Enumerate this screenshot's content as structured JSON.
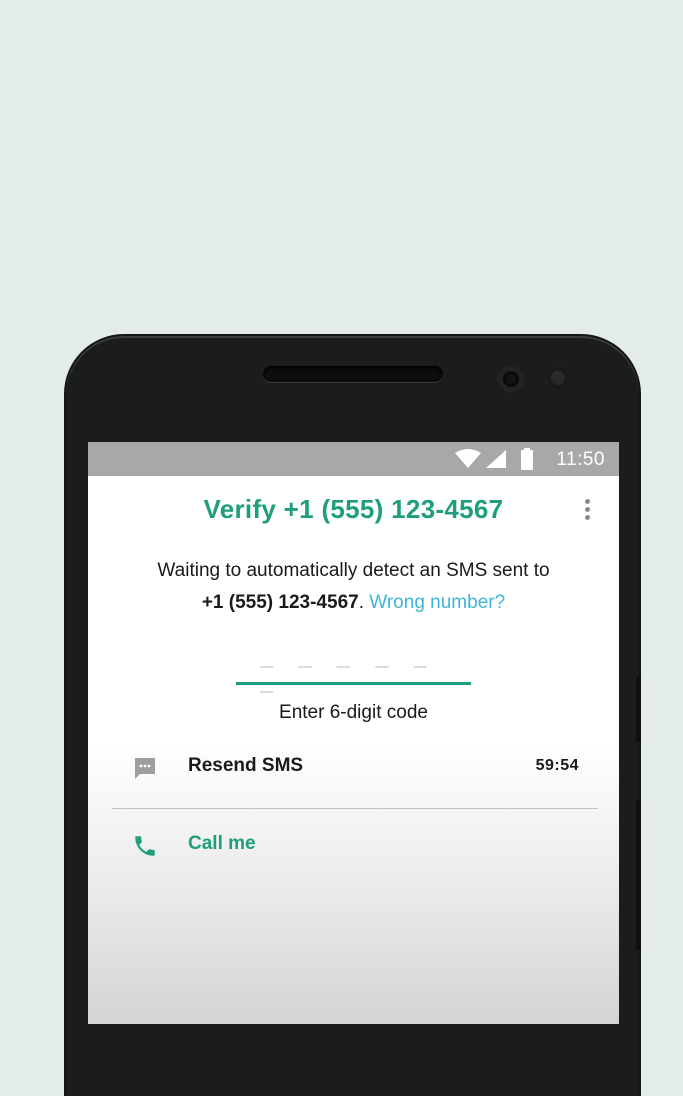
{
  "status_bar": {
    "time": "11:50",
    "icons": [
      "wifi-icon",
      "signal-icon",
      "battery-icon"
    ]
  },
  "header": {
    "title": "Verify +1 (555) 123-4567",
    "menu_icon": "more-vert-icon"
  },
  "description": {
    "line1": "Waiting to automatically detect an SMS sent to",
    "phone": "+1 (555) 123-4567",
    "after_phone": ".",
    "wrong_number_link": "Wrong number?"
  },
  "code_entry": {
    "placeholder": "_ _ _  _ _ _",
    "hint": "Enter 6-digit code"
  },
  "actions": {
    "resend": {
      "label": "Resend SMS",
      "timer": "59:54",
      "icon": "message-icon"
    },
    "call": {
      "label": "Call me",
      "icon": "phone-icon"
    }
  },
  "colors": {
    "accent": "#1e9e7c",
    "link": "#3fb6d8",
    "status_bar": "#a8a8a8",
    "background": "#e3ecea"
  }
}
